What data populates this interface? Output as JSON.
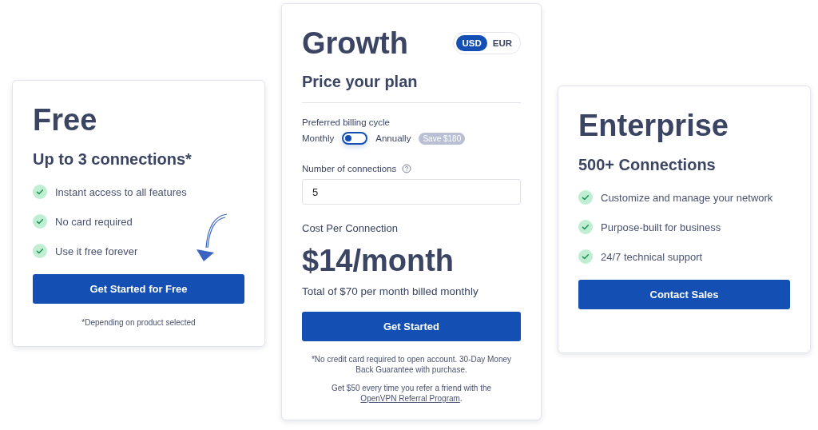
{
  "plans": [
    {
      "kind": "simple",
      "name": "Free",
      "subtitle": "Up to 3 connections*",
      "features": [
        "Instant access to all features",
        "No card required",
        "Use it free forever"
      ],
      "button": "Get Started for Free",
      "footnote": "*Depending on product selected",
      "hint_arrow": true
    },
    {
      "kind": "calculator",
      "name": "Growth",
      "currencies": [
        {
          "label": "USD",
          "selected": true
        },
        {
          "label": "EUR",
          "selected": false
        }
      ],
      "subtitle": "Price your plan",
      "billing_label": "Preferred billing cycle",
      "billing_options": [
        "Monthly",
        "Annually"
      ],
      "annual_billing": false,
      "savings_badge": "Save $180",
      "connections_label": "Number of connections",
      "connections_value": "5",
      "cost_label": "Cost Per Connection",
      "price": "$14/month",
      "total": "Total of $70 per month billed monthly",
      "button": "Get Started",
      "disclaimer": "*No credit card required to open account. 30-Day Money Back Guarantee with purchase.",
      "referral_text": "Get $50 every time you refer a friend with the",
      "referral_link": "OpenVPN Referral Program",
      "referral_suffix": "."
    },
    {
      "kind": "simple",
      "name": "Enterprise",
      "subtitle": "500+ Connections",
      "features": [
        "Customize and manage your network",
        "Purpose-built for business",
        "24/7 technical support"
      ],
      "button": "Contact Sales",
      "hint_arrow": false
    }
  ]
}
